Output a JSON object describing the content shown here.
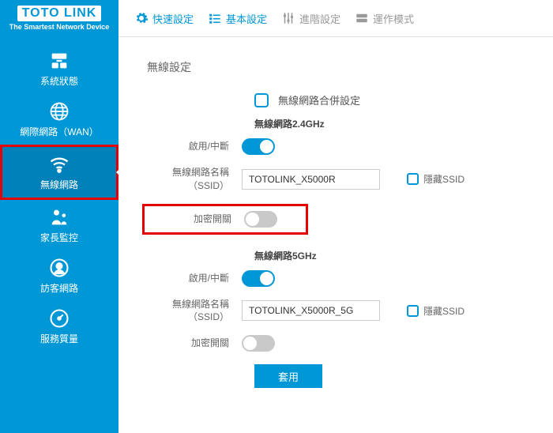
{
  "brand": {
    "logo": "TOTO LINK",
    "tagline": "The Smartest Network Device"
  },
  "topnav": {
    "quick": "快速設定",
    "basic": "基本設定",
    "advanced": "進階設定",
    "mode": "運作模式"
  },
  "sidebar": {
    "status": "系統狀態",
    "wan": "網際網路（WAN）",
    "wireless": "無線網路",
    "parental": "家長監控",
    "guest": "訪客網路",
    "qos": "服務質量"
  },
  "page": {
    "title": "無線設定",
    "merge": "無線網路合併設定",
    "band24": "無線網路2.4GHz",
    "band5": "無線網路5GHz",
    "enable": "啟用/中斷",
    "ssid_label1": "無線網路名稱",
    "ssid_label2": "（SSID）",
    "encrypt": "加密開關",
    "hide": "隱藏SSID",
    "apply": "套用",
    "ssid24": "TOTOLINK_X5000R",
    "ssid5": "TOTOLINK_X5000R_5G"
  }
}
